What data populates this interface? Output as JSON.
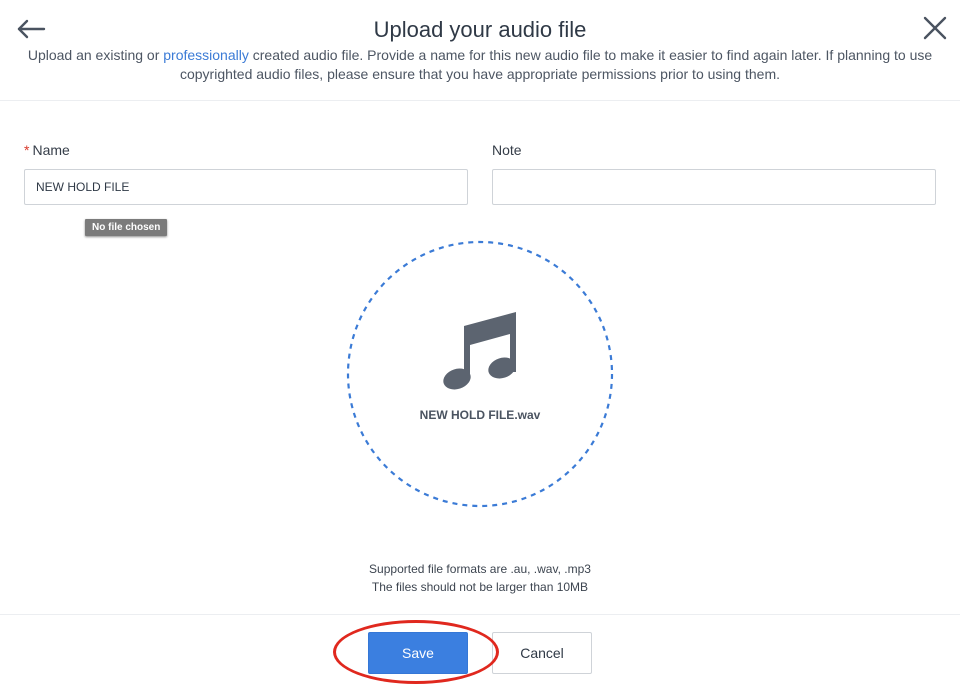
{
  "dialog": {
    "title": "Upload your audio file",
    "subtitle": {
      "before": "Upload an existing or ",
      "link": "professionally",
      "after": " created audio file. Provide a name for this new audio file to make it easier to find again later. If planning to use copyrighted audio files, please ensure that you have appropriate permissions prior to using them."
    },
    "back_icon": "arrow-left-icon",
    "close_icon": "close-icon"
  },
  "form": {
    "name": {
      "required_mark": "*",
      "label": "Name",
      "value": "NEW HOLD FILE"
    },
    "note": {
      "label": "Note",
      "value": ""
    },
    "file_tooltip": "No file chosen"
  },
  "dropzone": {
    "icon": "music-note-icon",
    "file_name": "NEW HOLD FILE.wav",
    "border_color": "#3b7bd6"
  },
  "formats": {
    "line1": "Supported file formats are .au, .wav, .mp3",
    "line2": "The files should not be larger than 10MB"
  },
  "footer": {
    "save_label": "Save",
    "cancel_label": "Cancel"
  },
  "colors": {
    "accent": "#3b7fe0",
    "link": "#3b7bd6",
    "highlight": "#e0281e",
    "icon": "#5c6470"
  }
}
